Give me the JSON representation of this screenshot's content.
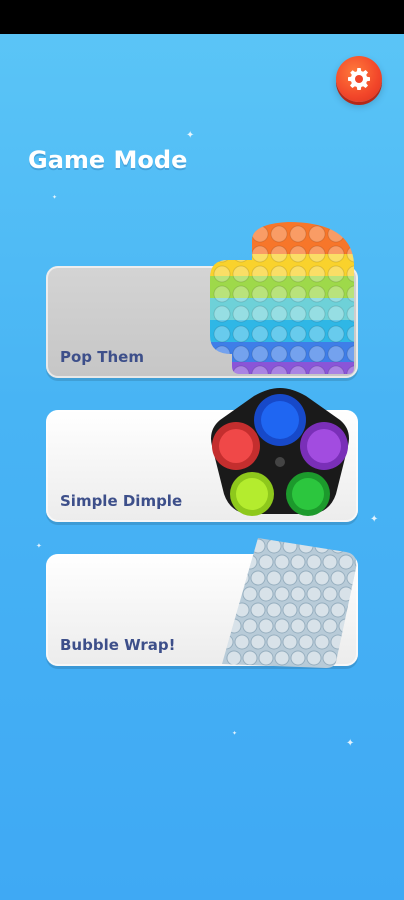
{
  "title": "Game Mode",
  "settings_icon": "gear-icon",
  "modes": [
    {
      "label": "Pop Them",
      "icon": "rainbow-pop-it-icon"
    },
    {
      "label": "Simple Dimple",
      "icon": "simple-dimple-icon"
    },
    {
      "label": "Bubble Wrap!",
      "icon": "bubble-wrap-icon"
    }
  ],
  "colors": {
    "background_top": "#5cc6f7",
    "background_bottom": "#3fa9f4",
    "settings_button": "#f2462a",
    "label_text": "#3d4f8a"
  }
}
